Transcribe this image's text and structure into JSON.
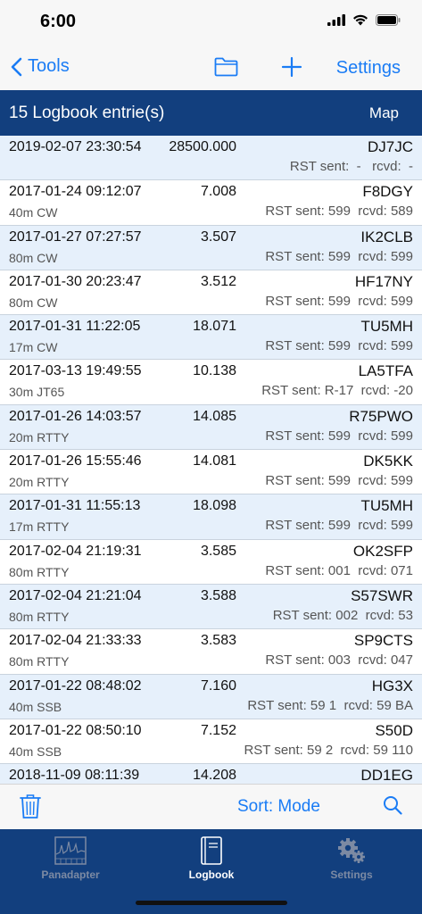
{
  "status": {
    "time": "6:00"
  },
  "nav": {
    "back_label": "Tools",
    "settings_label": "Settings",
    "folder_icon": "folder-icon",
    "plus_icon": "plus-icon"
  },
  "header": {
    "title": "15 Logbook entrie(s)",
    "map_label": "Map"
  },
  "entries": [
    {
      "datetime": "2019-02-07 23:30:54",
      "freq": "28500.000",
      "call": "DJ7JC",
      "mode": "",
      "rst": "RST sent:  -   rcvd:  -"
    },
    {
      "datetime": "2017-01-24 09:12:07",
      "freq": "7.008",
      "call": "F8DGY",
      "mode": "40m CW",
      "rst": "RST sent: 599  rcvd: 589"
    },
    {
      "datetime": "2017-01-27 07:27:57",
      "freq": "3.507",
      "call": "IK2CLB",
      "mode": "80m CW",
      "rst": "RST sent: 599  rcvd: 599"
    },
    {
      "datetime": "2017-01-30 20:23:47",
      "freq": "3.512",
      "call": "HF17NY",
      "mode": "80m CW",
      "rst": "RST sent: 599  rcvd: 599"
    },
    {
      "datetime": "2017-01-31 11:22:05",
      "freq": "18.071",
      "call": "TU5MH",
      "mode": "17m CW",
      "rst": "RST sent: 599  rcvd: 599"
    },
    {
      "datetime": "2017-03-13 19:49:55",
      "freq": "10.138",
      "call": "LA5TFA",
      "mode": "30m JT65",
      "rst": "RST sent: R-17  rcvd: -20"
    },
    {
      "datetime": "2017-01-26 14:03:57",
      "freq": "14.085",
      "call": "R75PWO",
      "mode": "20m RTTY",
      "rst": "RST sent: 599  rcvd: 599"
    },
    {
      "datetime": "2017-01-26 15:55:46",
      "freq": "14.081",
      "call": "DK5KK",
      "mode": "20m RTTY",
      "rst": "RST sent: 599  rcvd: 599"
    },
    {
      "datetime": "2017-01-31 11:55:13",
      "freq": "18.098",
      "call": "TU5MH",
      "mode": "17m RTTY",
      "rst": "RST sent: 599  rcvd: 599"
    },
    {
      "datetime": "2017-02-04 21:19:31",
      "freq": "3.585",
      "call": "OK2SFP",
      "mode": "80m RTTY",
      "rst": "RST sent: 001  rcvd: 071"
    },
    {
      "datetime": "2017-02-04 21:21:04",
      "freq": "3.588",
      "call": "S57SWR",
      "mode": "80m RTTY",
      "rst": "RST sent: 002  rcvd: 53"
    },
    {
      "datetime": "2017-02-04 21:33:33",
      "freq": "3.583",
      "call": "SP9CTS",
      "mode": "80m RTTY",
      "rst": "RST sent: 003  rcvd: 047"
    },
    {
      "datetime": "2017-01-22 08:48:02",
      "freq": "7.160",
      "call": "HG3X",
      "mode": "40m SSB",
      "rst": "RST sent: 59 1  rcvd: 59 BA"
    },
    {
      "datetime": "2017-01-22 08:50:10",
      "freq": "7.152",
      "call": "S50D",
      "mode": "40m SSB",
      "rst": "RST sent: 59 2  rcvd: 59 110"
    },
    {
      "datetime": "2018-11-09 08:11:39",
      "freq": "14.208",
      "call": "DD1EG",
      "mode": "",
      "rst": ""
    }
  ],
  "toolbar": {
    "sort_label": "Sort: Mode",
    "trash_icon": "trash-icon",
    "search_icon": "search-icon"
  },
  "tabs": [
    {
      "label": "Panadapter",
      "icon": "panadapter-icon",
      "active": false
    },
    {
      "label": "Logbook",
      "icon": "logbook-icon",
      "active": true
    },
    {
      "label": "Settings",
      "icon": "gear-icon",
      "active": false
    }
  ],
  "colors": {
    "accent": "#1a7cf5",
    "header_bg": "#123f7e",
    "row_alt": "#e6f0fb"
  }
}
